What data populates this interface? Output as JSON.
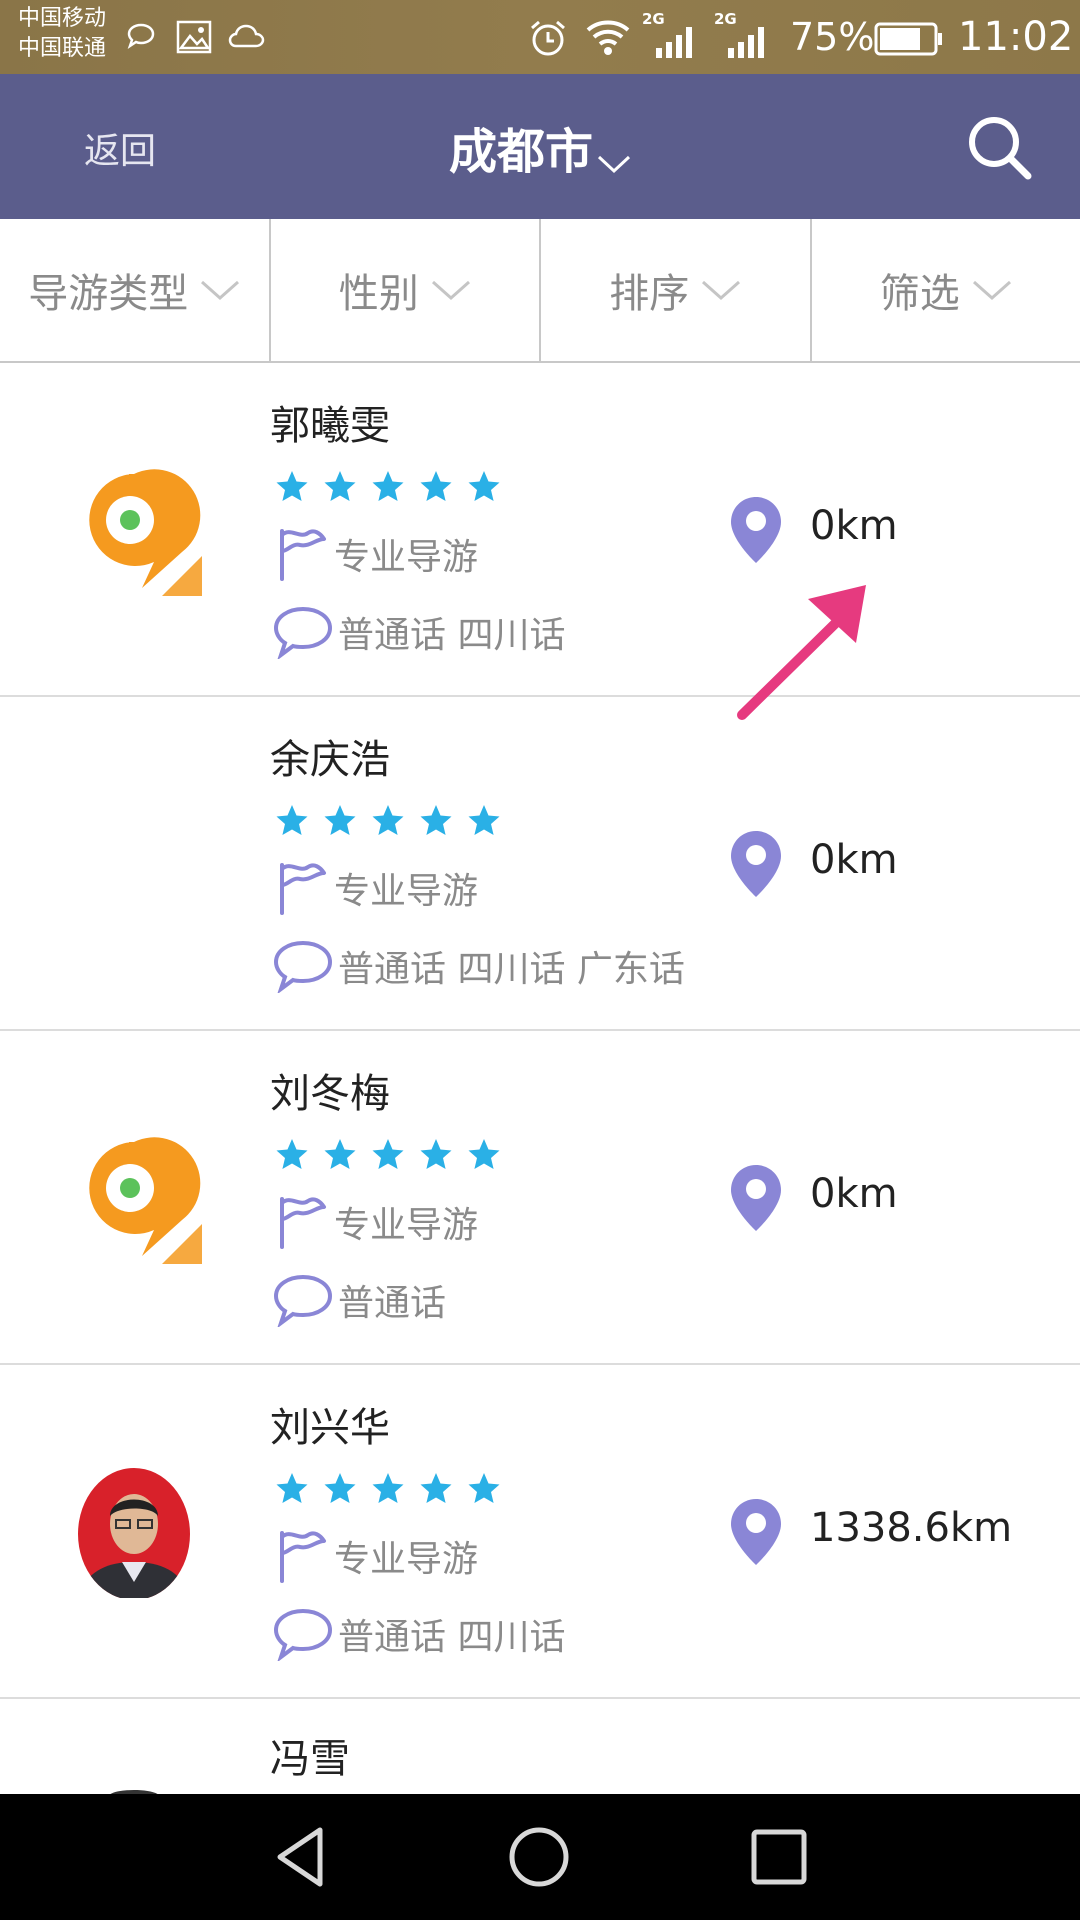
{
  "status_bar": {
    "carrier_1": "中国移动",
    "carrier_2": "中国联通",
    "signal_label_1": "2G",
    "signal_label_2": "2G",
    "battery": "75%",
    "time": "11:02"
  },
  "header": {
    "back_label": "返回",
    "city": "成都市"
  },
  "filters": [
    {
      "label": "导游类型"
    },
    {
      "label": "性别"
    },
    {
      "label": "排序"
    },
    {
      "label": "筛选"
    }
  ],
  "guides": [
    {
      "name": "郭曦雯",
      "rating": 5,
      "type": "专业导游",
      "languages": "普通话 四川话",
      "distance": "0km",
      "avatar": "app-logo"
    },
    {
      "name": "余庆浩",
      "rating": 5,
      "type": "专业导游",
      "languages": "普通话 四川话 广东话",
      "distance": "0km",
      "avatar": "none"
    },
    {
      "name": "刘冬梅",
      "rating": 5,
      "type": "专业导游",
      "languages": "普通话",
      "distance": "0km",
      "avatar": "app-logo"
    },
    {
      "name": "刘兴华",
      "rating": 5,
      "type": "专业导游",
      "languages": "普通话 四川话",
      "distance": "1338.6km",
      "avatar": "photo"
    },
    {
      "name": "冯雪"
    }
  ],
  "colors": {
    "header_bg": "#5b5d8c",
    "status_bg": "#8d7849",
    "star": "#2ab0e6",
    "icon_purple": "#8a86d6",
    "arrow": "#e63a7f",
    "logo_orange": "#f59a1f",
    "logo_green": "#5cc25b"
  },
  "icons": {
    "search": "search-icon",
    "chevron": "chevron-down-icon",
    "flag": "flag-icon",
    "speech": "speech-bubble-icon",
    "pin": "location-pin-icon",
    "star": "star-icon"
  }
}
